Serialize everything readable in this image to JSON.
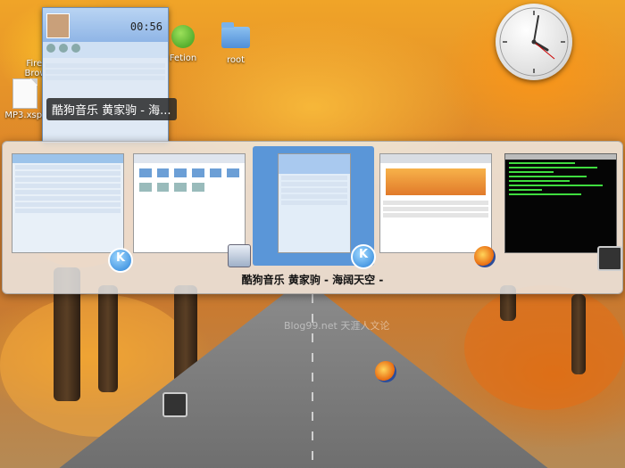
{
  "desktop": {
    "icons": [
      {
        "label": "Firef",
        "sub": "Brow"
      },
      {
        "label": "MP3.xspf"
      },
      {
        "label": "Fetion"
      },
      {
        "label": "root"
      }
    ],
    "watermark": "Blog99.net 天涯人文论"
  },
  "player": {
    "time": "00:56",
    "caption": "酷狗音乐 黄家驹 - 海..."
  },
  "switcher": {
    "selected_title": "酷狗音乐  黄家驹 - 海阔天空 -",
    "items": [
      {
        "name": "kugou-list-window",
        "badge": "K"
      },
      {
        "name": "file-manager-window",
        "badge": ""
      },
      {
        "name": "kugou-music-window",
        "badge": "K"
      },
      {
        "name": "firefox-window",
        "badge": ""
      },
      {
        "name": "terminal-window",
        "badge": ""
      }
    ]
  },
  "colors": {
    "selection": "#5a96d8",
    "panel": "#eeeeee",
    "terminal_text": "#3fdc3f"
  }
}
